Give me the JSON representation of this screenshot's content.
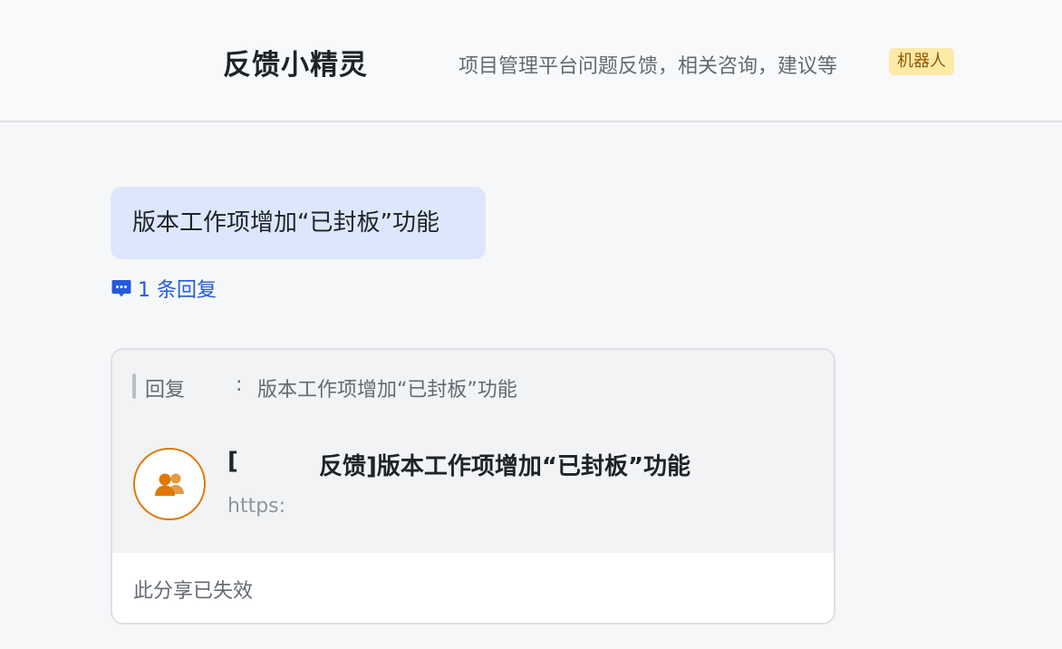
{
  "header": {
    "title": "反馈小精灵",
    "description": "项目管理平台问题反馈，相关咨询，建议等",
    "badge": "机器人"
  },
  "message": {
    "text": "版本工作项增加“已封板”功能",
    "reply_count": "1 条回复"
  },
  "card": {
    "quote_label": "回复",
    "quote_separator": ":",
    "quote_text": "版本工作项增加“已封板”功能",
    "link_title_open": "[",
    "link_title_rest": "反馈]版本工作项增加“已封板”功能",
    "link_url": "https:",
    "expired_text": "此分享已失效"
  },
  "icons": {
    "reply": "comment-bubble-icon",
    "group": "group-people-icon"
  },
  "colors": {
    "accent": "#245bdb",
    "bubble": "#dde7fb",
    "badge_bg": "#fdeaa8",
    "avatar": "#de7802"
  }
}
